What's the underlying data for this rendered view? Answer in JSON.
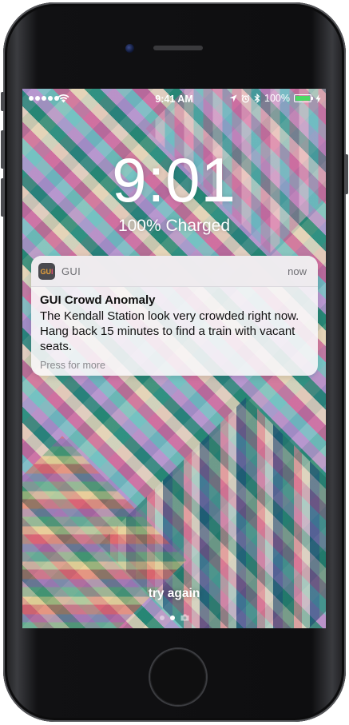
{
  "status_bar": {
    "time": "9:41 AM",
    "battery_percent": "100%",
    "battery_level": 1.0,
    "signal_bars": 5,
    "icons": [
      "signal-icon",
      "wifi-icon",
      "location-icon",
      "alarm-icon",
      "bluetooth-icon",
      "battery-icon",
      "charging-icon"
    ]
  },
  "lock_screen": {
    "time": "9:01",
    "charge_status": "100% Charged",
    "bottom_hint": "try again",
    "page_dots": 2,
    "active_dot": 1
  },
  "notification": {
    "app_name": "GUI",
    "time": "now",
    "title": "GUI Crowd Anomaly",
    "message": "The Kendall Station look very crowded right now. Hang back 15 minutes to find a train with vacant seats.",
    "hint": "Press for more",
    "app_icon_text": "GUI"
  },
  "colors": {
    "battery_fill": "#4cd964",
    "notification_bg": "#f8f6f8",
    "app_icon_bg": "#4a4a4f"
  }
}
